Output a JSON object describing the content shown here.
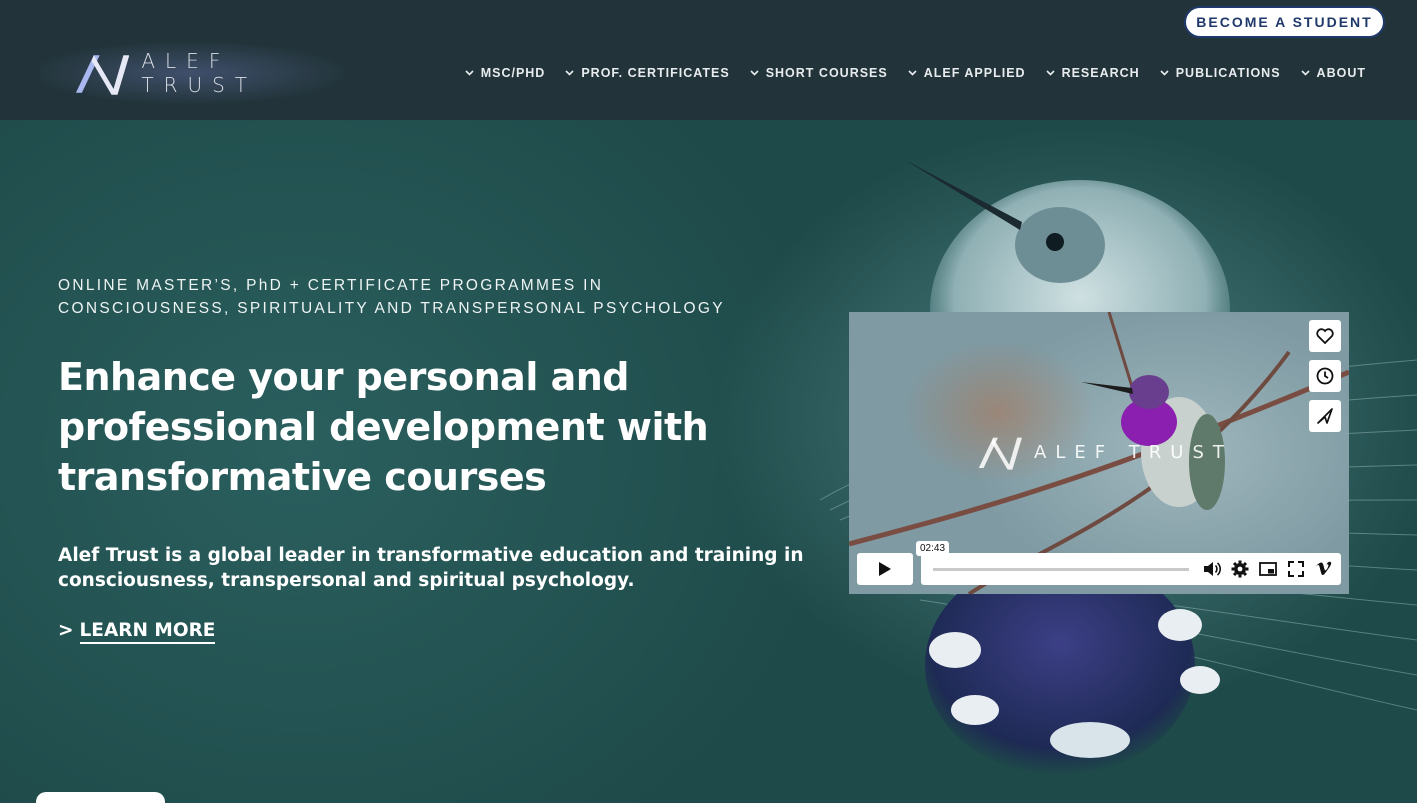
{
  "header": {
    "logo_text": "ALEF TRUST",
    "cta_label": "BECOME A STUDENT",
    "nav": [
      {
        "label": "MSC/PHD"
      },
      {
        "label": "PROF. CERTIFICATES"
      },
      {
        "label": "SHORT COURSES"
      },
      {
        "label": "ALEF APPLIED"
      },
      {
        "label": "RESEARCH"
      },
      {
        "label": "PUBLICATIONS"
      },
      {
        "label": "ABOUT"
      }
    ]
  },
  "hero": {
    "eyebrow": "ONLINE MASTER’S, PhD + CERTIFICATE PROGRAMMES IN CONSCIOUSNESS, SPIRITUALITY AND TRANSPERSONAL PSYCHOLOGY",
    "headline": "Enhance your personal and professional development with transformative courses",
    "lead": "Alef Trust is a global leader in transformative education and training in consciousness, transpersonal and spiritual psychology.",
    "learn_prefix": ">",
    "learn_label": "LEARN MORE"
  },
  "video": {
    "watermark": "ALEF TRUST",
    "time": "02:43",
    "side_icons": [
      "heart-icon",
      "clock-icon",
      "send-icon"
    ],
    "control_icons": [
      "volume-icon",
      "settings-icon",
      "pip-icon",
      "fullscreen-icon",
      "vimeo-icon"
    ]
  },
  "colors": {
    "background": "#1f4a49",
    "header": "#22343a",
    "cta_border": "#1f3a6a",
    "text": "#ffffff"
  }
}
